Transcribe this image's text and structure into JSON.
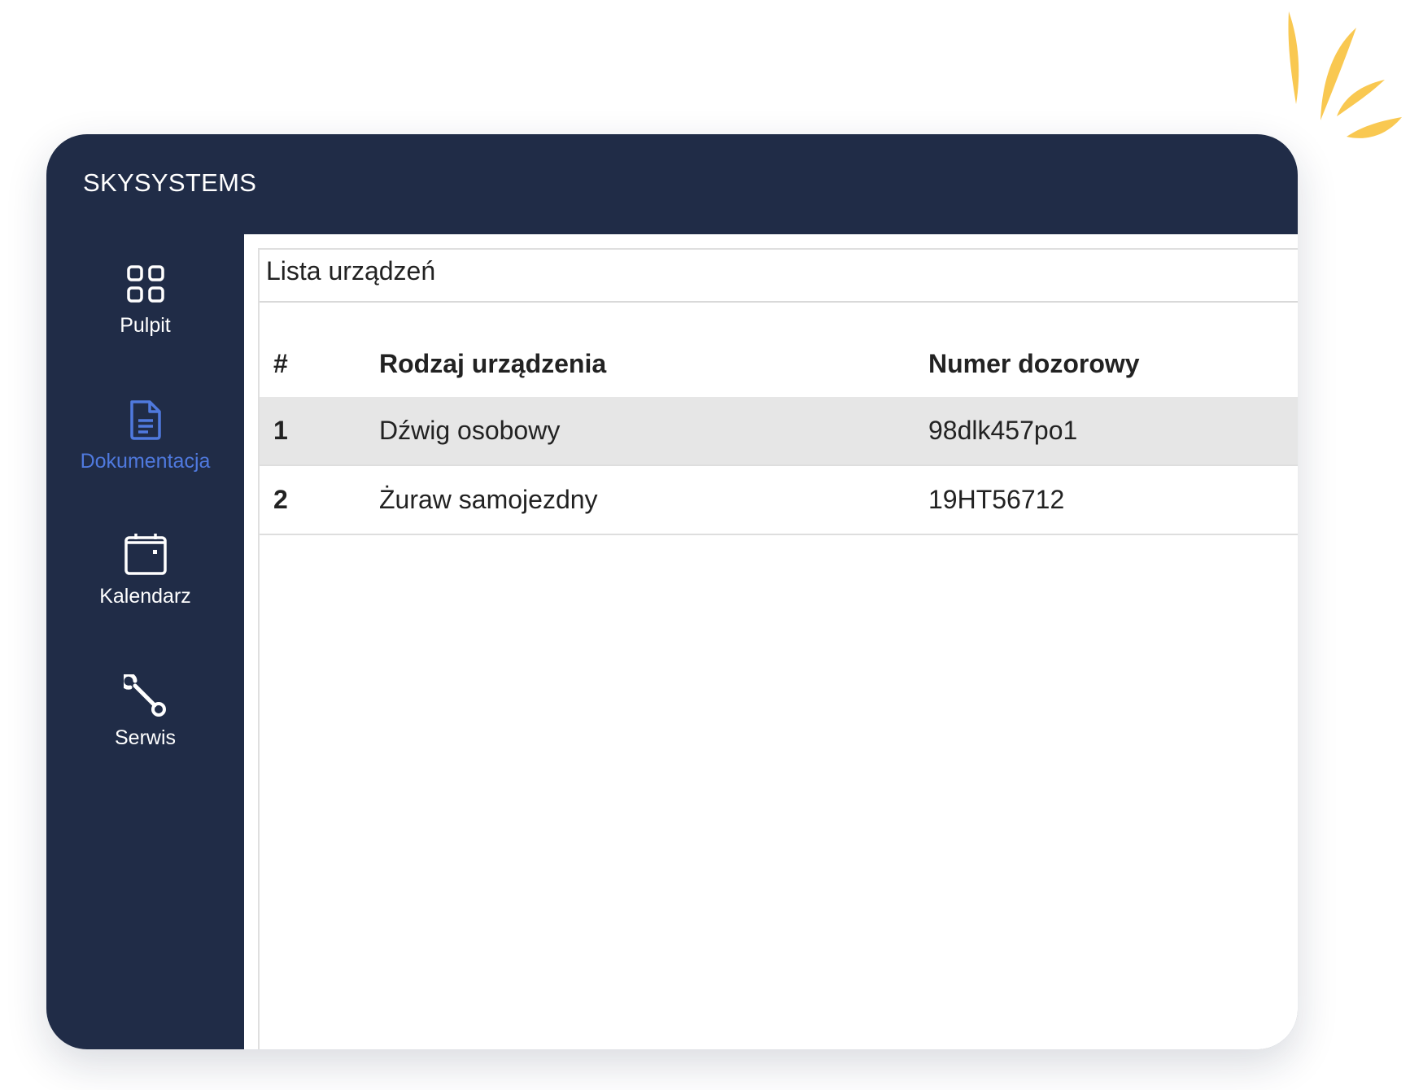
{
  "app": {
    "brand": "SKYSYSTEMS"
  },
  "sidebar": {
    "items": [
      {
        "label": "Pulpit",
        "icon": "grid-icon",
        "active": false
      },
      {
        "label": "Dokumentacja",
        "icon": "document-icon",
        "active": true
      },
      {
        "label": "Kalendarz",
        "icon": "calendar-icon",
        "active": false
      },
      {
        "label": "Serwis",
        "icon": "wrench-icon",
        "active": false
      }
    ]
  },
  "main": {
    "title": "Lista urządzeń",
    "table": {
      "columns": [
        "#",
        "Rodzaj urządzenia",
        "Numer dozorowy"
      ],
      "rows": [
        {
          "num": "1",
          "type": "Dźwig osobowy",
          "number": "98dlk457po1",
          "selected": true
        },
        {
          "num": "2",
          "type": "Żuraw samojezdny",
          "number": "19HT56712",
          "selected": false
        }
      ]
    }
  },
  "colors": {
    "sidebar_bg": "#202c47",
    "accent": "#4f79de",
    "selected_row": "#e6e6e6",
    "decoration": "#f9c851"
  }
}
